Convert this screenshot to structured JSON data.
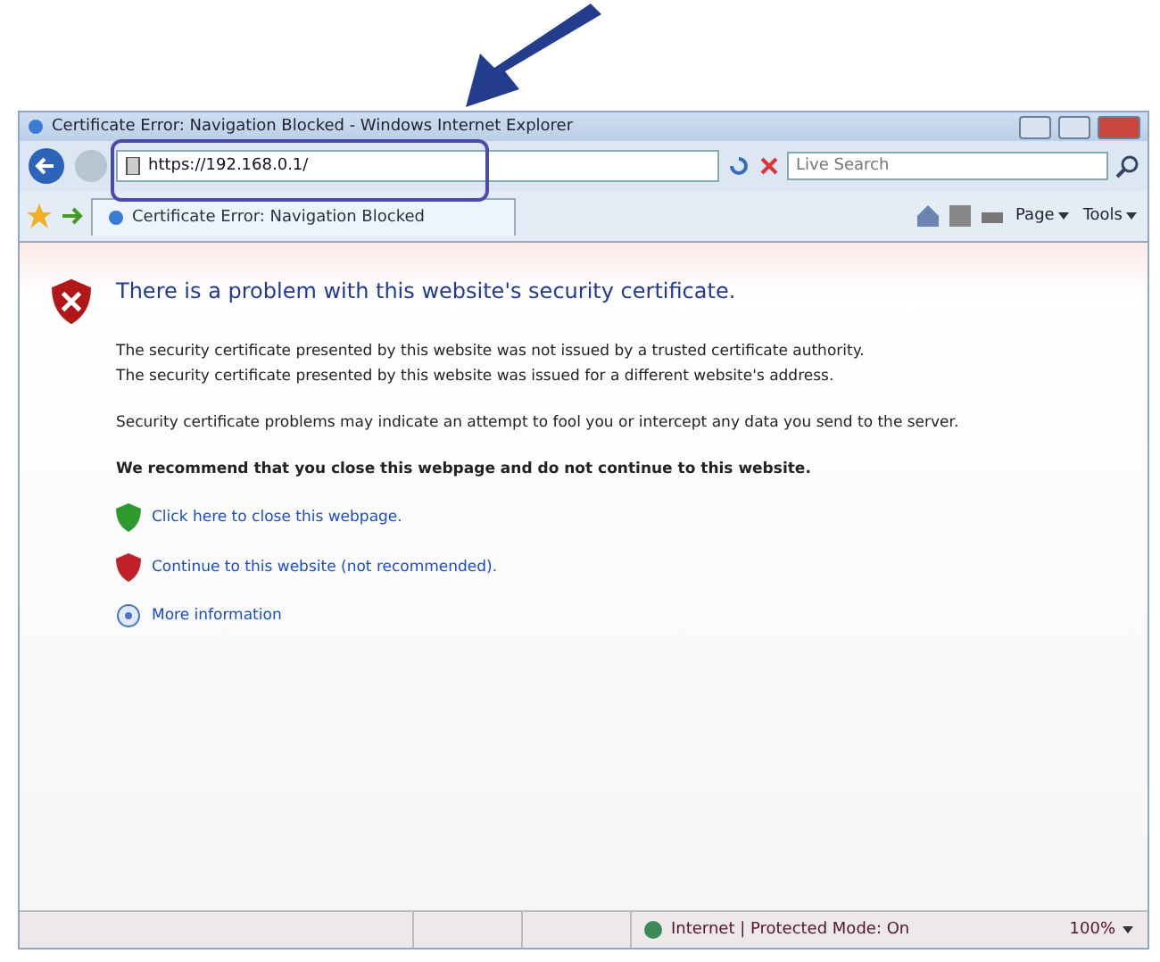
{
  "window": {
    "title": "Certificate Error: Navigation Blocked - Windows Internet Explorer"
  },
  "address_bar": {
    "value": "https://192.168.0.1/",
    "highlighted": true
  },
  "search": {
    "placeholder": "Live Search"
  },
  "tab": {
    "label": "Certificate Error: Navigation Blocked",
    "selected": true
  },
  "command_bar": [
    {
      "label": "Page"
    },
    {
      "label": "Tools"
    }
  ],
  "page": {
    "heading": "There is a problem with this website's security certificate.",
    "paragraphs": [
      "The security certificate presented by this website was not issued by a trusted certificate authority.\nThe security certificate presented by this website was issued for a different website's address.",
      "Security certificate problems may indicate an attempt to fool you or intercept any data you send to the server."
    ],
    "recommendation": "We recommend that you close this webpage and do not continue to this website.",
    "links": [
      {
        "kind": "close",
        "label": "Click here to close this webpage."
      },
      {
        "kind": "continue",
        "label": "Continue to this website (not recommended)."
      },
      {
        "kind": "info",
        "label": "More information"
      }
    ]
  },
  "status_bar": {
    "zone": "Internet | Protected Mode: On",
    "zoom": "100%"
  }
}
